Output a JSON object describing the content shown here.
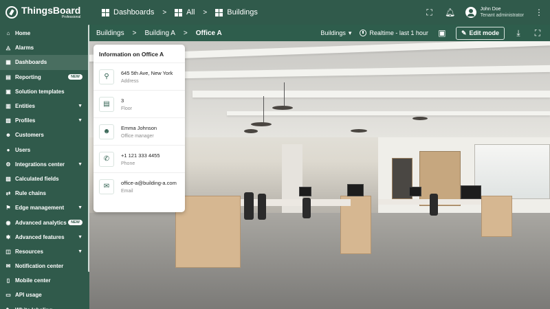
{
  "app": {
    "logo_name": "ThingsBoard",
    "logo_sub": "Professional"
  },
  "topbar": {
    "breadcrumbs": [
      "Dashboards",
      "All",
      "Buildings"
    ],
    "separator": ">",
    "user_name": "John Doe",
    "user_role": "Tenant administrator"
  },
  "sidebar": {
    "items": [
      {
        "label": "Home",
        "icon": "home-icon",
        "glyph": "⌂",
        "chevron": false,
        "badge": ""
      },
      {
        "label": "Alarms",
        "icon": "alarm-icon",
        "glyph": "◬",
        "chevron": false,
        "badge": ""
      },
      {
        "label": "Dashboards",
        "icon": "dashboard-icon",
        "glyph": "▦",
        "chevron": false,
        "badge": ""
      },
      {
        "label": "Reporting",
        "icon": "report-icon",
        "glyph": "▤",
        "chevron": false,
        "badge": "NEW"
      },
      {
        "label": "Solution templates",
        "icon": "template-icon",
        "glyph": "▣",
        "chevron": false,
        "badge": ""
      },
      {
        "label": "Entities",
        "icon": "entities-icon",
        "glyph": "▥",
        "chevron": true,
        "badge": ""
      },
      {
        "label": "Profiles",
        "icon": "profiles-icon",
        "glyph": "▧",
        "chevron": true,
        "badge": ""
      },
      {
        "label": "Customers",
        "icon": "customers-icon",
        "glyph": "☻",
        "chevron": false,
        "badge": ""
      },
      {
        "label": "Users",
        "icon": "users-icon",
        "glyph": "●",
        "chevron": false,
        "badge": ""
      },
      {
        "label": "Integrations center",
        "icon": "integrations-icon",
        "glyph": "⚙",
        "chevron": true,
        "badge": ""
      },
      {
        "label": "Calculated fields",
        "icon": "calculated-icon",
        "glyph": "▨",
        "chevron": false,
        "badge": ""
      },
      {
        "label": "Rule chains",
        "icon": "rule-chains-icon",
        "glyph": "⇄",
        "chevron": false,
        "badge": ""
      },
      {
        "label": "Edge management",
        "icon": "edge-icon",
        "glyph": "⚑",
        "chevron": true,
        "badge": ""
      },
      {
        "label": "Advanced analytics",
        "icon": "analytics-icon",
        "glyph": "◉",
        "chevron": false,
        "badge": "NEW"
      },
      {
        "label": "Advanced features",
        "icon": "features-icon",
        "glyph": "✱",
        "chevron": true,
        "badge": ""
      },
      {
        "label": "Resources",
        "icon": "resources-icon",
        "glyph": "◫",
        "chevron": true,
        "badge": ""
      },
      {
        "label": "Notification center",
        "icon": "notification-icon",
        "glyph": "✉",
        "chevron": false,
        "badge": ""
      },
      {
        "label": "Mobile center",
        "icon": "mobile-icon",
        "glyph": "▯",
        "chevron": false,
        "badge": ""
      },
      {
        "label": "API usage",
        "icon": "api-icon",
        "glyph": "▭",
        "chevron": false,
        "badge": ""
      },
      {
        "label": "White labeling",
        "icon": "white-label-icon",
        "glyph": "✎",
        "chevron": false,
        "badge": ""
      }
    ]
  },
  "dashboard": {
    "breadcrumbs": [
      "Buildings",
      "Building A",
      "Office A"
    ],
    "separator": ">",
    "state_select": "Buildings",
    "timewindow": "Realtime - last 1 hour",
    "edit_label": "Edit mode"
  },
  "info_card": {
    "title": "Information on Office A",
    "rows": [
      {
        "value": "645 5th Ave, New York",
        "label": "Address",
        "icon": "location-icon",
        "glyph": "⚲"
      },
      {
        "value": "3",
        "label": "Floor",
        "icon": "floor-icon",
        "glyph": "▤"
      },
      {
        "value": "Emma Johnson",
        "label": "Office manager",
        "icon": "person-icon",
        "glyph": "☻"
      },
      {
        "value": "+1 121 333 4455",
        "label": "Phone",
        "icon": "phone-icon",
        "glyph": "✆"
      },
      {
        "value": "office-a@building-a.com",
        "label": "Email",
        "icon": "email-icon",
        "glyph": "✉"
      }
    ]
  },
  "colors": {
    "brand": "#305a4b",
    "card_bg": "#ffffff"
  }
}
